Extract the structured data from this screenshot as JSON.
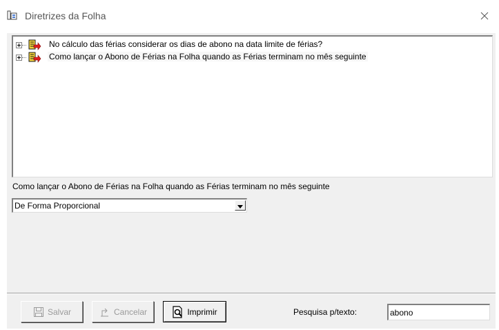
{
  "window": {
    "title": "Diretrizes da Folha",
    "app_icon": "form-icon",
    "close_icon": "close-icon"
  },
  "tree": {
    "items": [
      {
        "label": "No cálculo das férias considerar os dias de abono na data limite de férias?",
        "icon": "document-arrow-icon",
        "expanded": false,
        "selected": false
      },
      {
        "label": "Como lançar o Abono de Férias na Folha quando as Férias terminam no mês seguinte",
        "icon": "document-arrow-icon",
        "expanded": false,
        "selected": true
      }
    ]
  },
  "detail": {
    "question": "Como lançar o Abono de Férias na Folha quando as Férias terminam no mês seguinte",
    "selected_option": "De Forma Proporcional"
  },
  "toolbar": {
    "save_label": "Salvar",
    "cancel_label": "Cancelar",
    "print_label": "Imprimir",
    "search_label": "Pesquisa p/texto:",
    "search_value": "abono"
  }
}
